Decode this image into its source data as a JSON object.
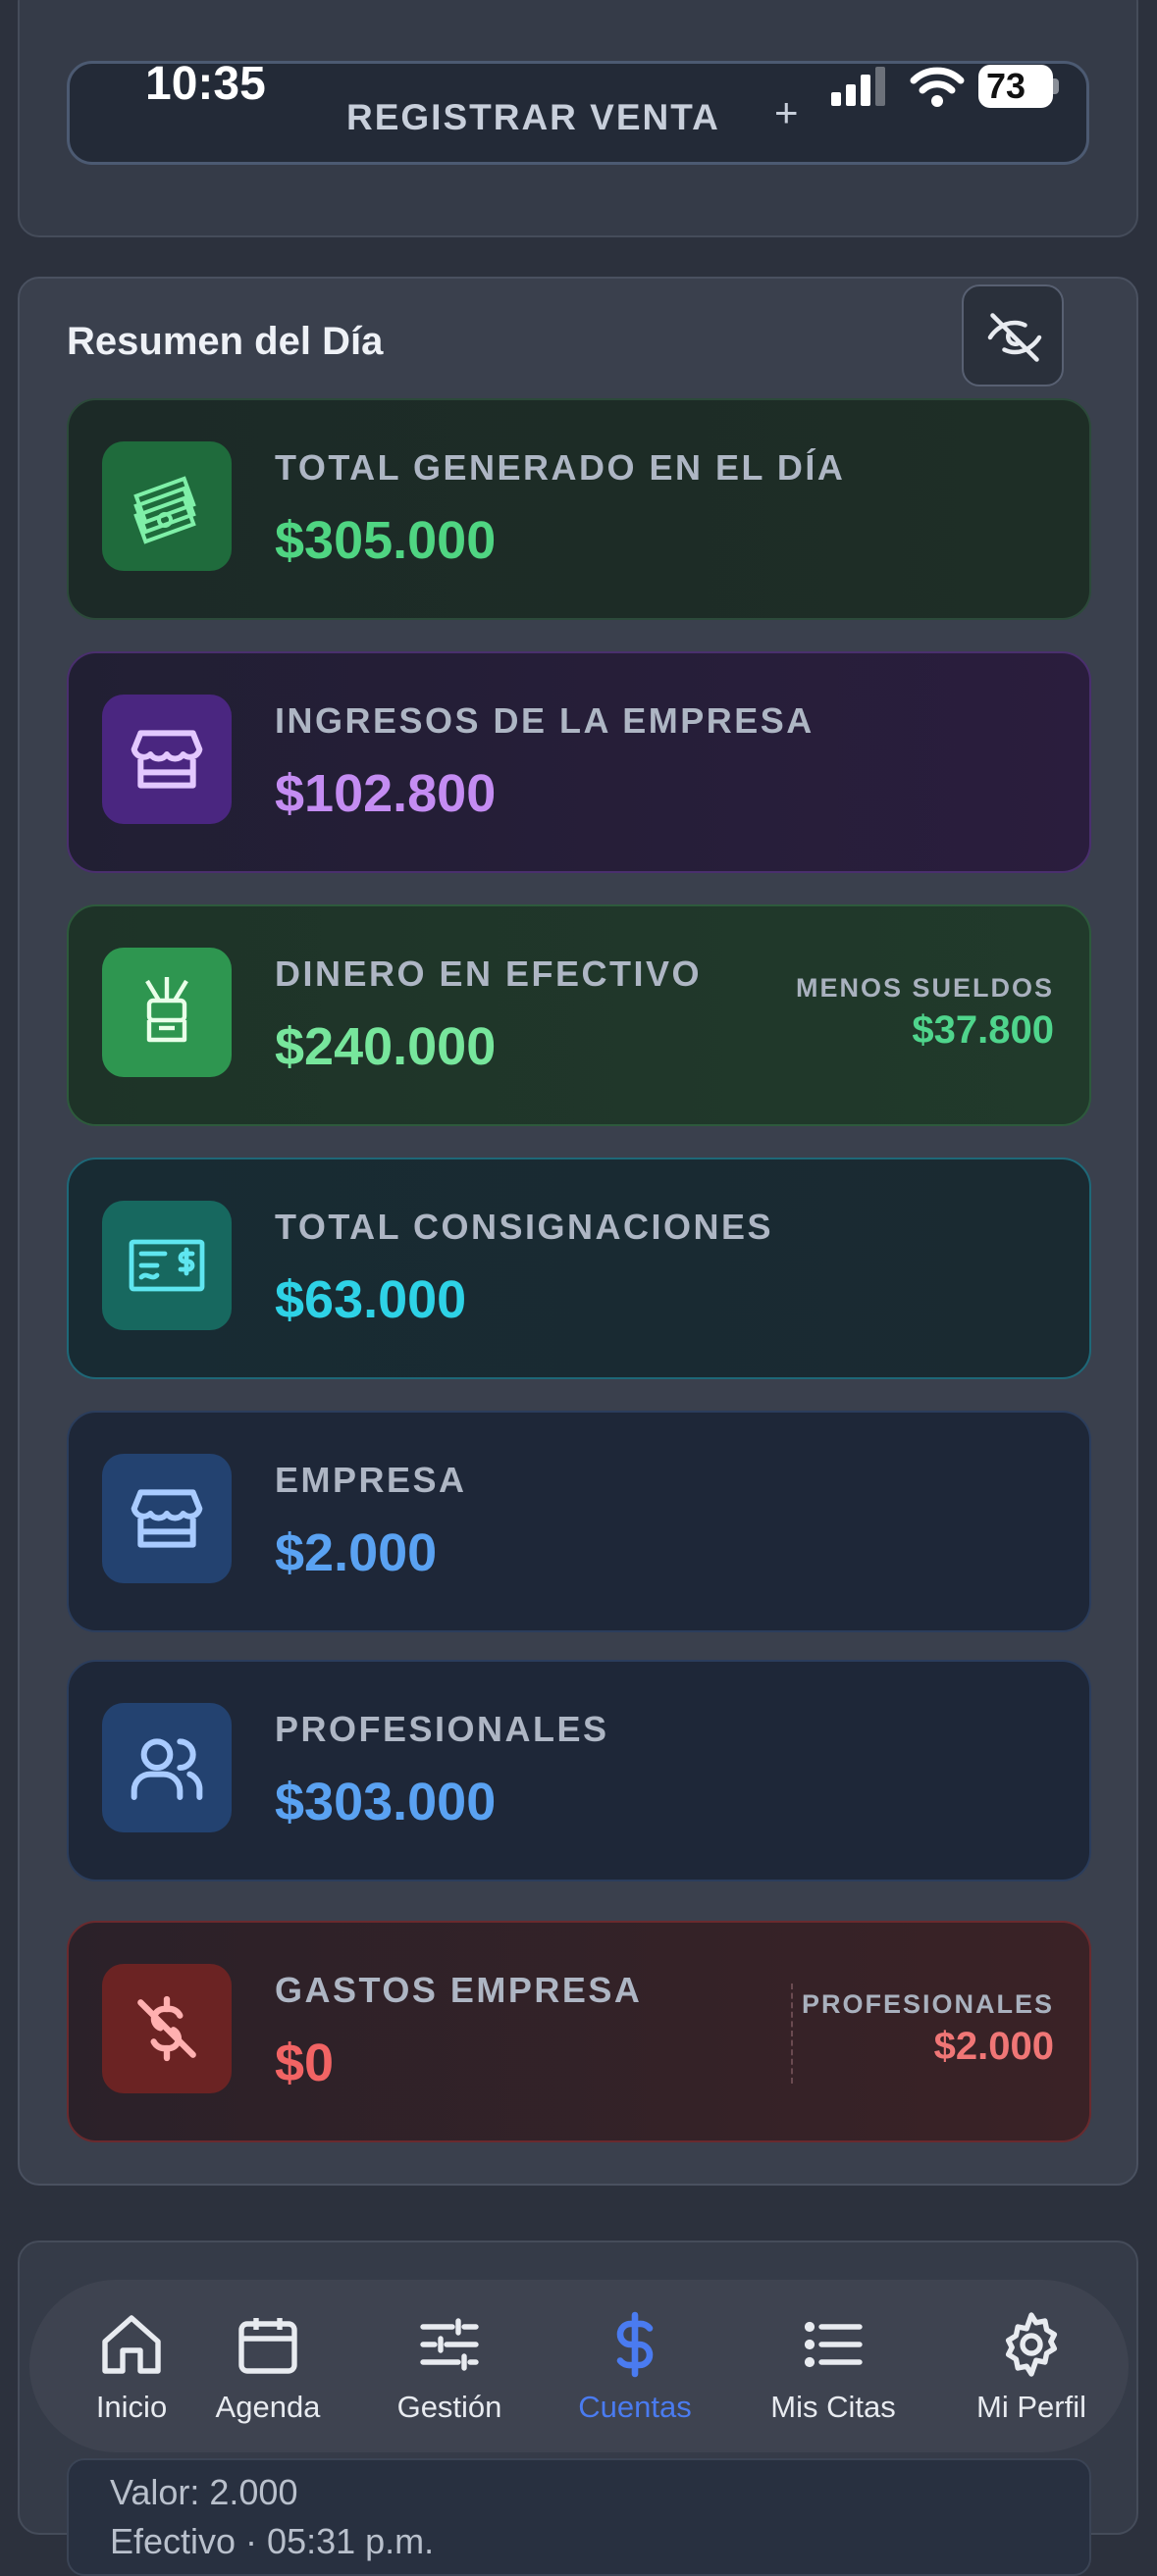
{
  "status_bar": {
    "time": "10:35",
    "battery": "73"
  },
  "top": {
    "register_label": "REGISTRAR VENTA",
    "register_plus": "+"
  },
  "summary": {
    "title": "Resumen del Día",
    "cards": [
      {
        "label": "TOTAL GENERADO EN EL DÍA",
        "value": "$305.000",
        "icon": "cash-bills-icon"
      },
      {
        "label": "INGRESOS DE LA EMPRESA",
        "value": "$102.800",
        "icon": "storefront-icon"
      },
      {
        "label": "DINERO EN EFECTIVO",
        "value": "$240.000",
        "icon": "hand-cash-icon",
        "side_label": "MENOS SUELDOS",
        "side_value": "$37.800"
      },
      {
        "label": "TOTAL CONSIGNACIONES",
        "value": "$63.000",
        "icon": "check-dollar-icon"
      },
      {
        "label": "EMPRESA",
        "value": "$2.000",
        "icon": "storefront-icon"
      },
      {
        "label": "PROFESIONALES",
        "value": "$303.000",
        "icon": "users-icon"
      },
      {
        "label": "GASTOS EMPRESA",
        "value": "$0",
        "icon": "dollar-off-icon",
        "side_label": "PROFESIONALES",
        "side_value": "$2.000"
      }
    ]
  },
  "lower": {
    "line1": "Valor: 2.000",
    "line2": "Efectivo  · 05:31 p.m."
  },
  "nav": {
    "items": [
      {
        "label": "Inicio",
        "icon": "home-icon"
      },
      {
        "label": "Agenda",
        "icon": "calendar-icon"
      },
      {
        "label": "Gestión",
        "icon": "sliders-icon"
      },
      {
        "label": "Cuentas",
        "icon": "dollar-icon",
        "active": true
      },
      {
        "label": "Mis Citas",
        "icon": "list-icon"
      },
      {
        "label": "Mi Perfil",
        "icon": "gear-icon"
      }
    ]
  },
  "colors": {
    "active_nav": "#4a7bf0",
    "green": "#4fd582",
    "purple": "#c48cf2",
    "cyan": "#2ed2e6",
    "blue": "#5aa2f2",
    "red": "#f26464"
  }
}
